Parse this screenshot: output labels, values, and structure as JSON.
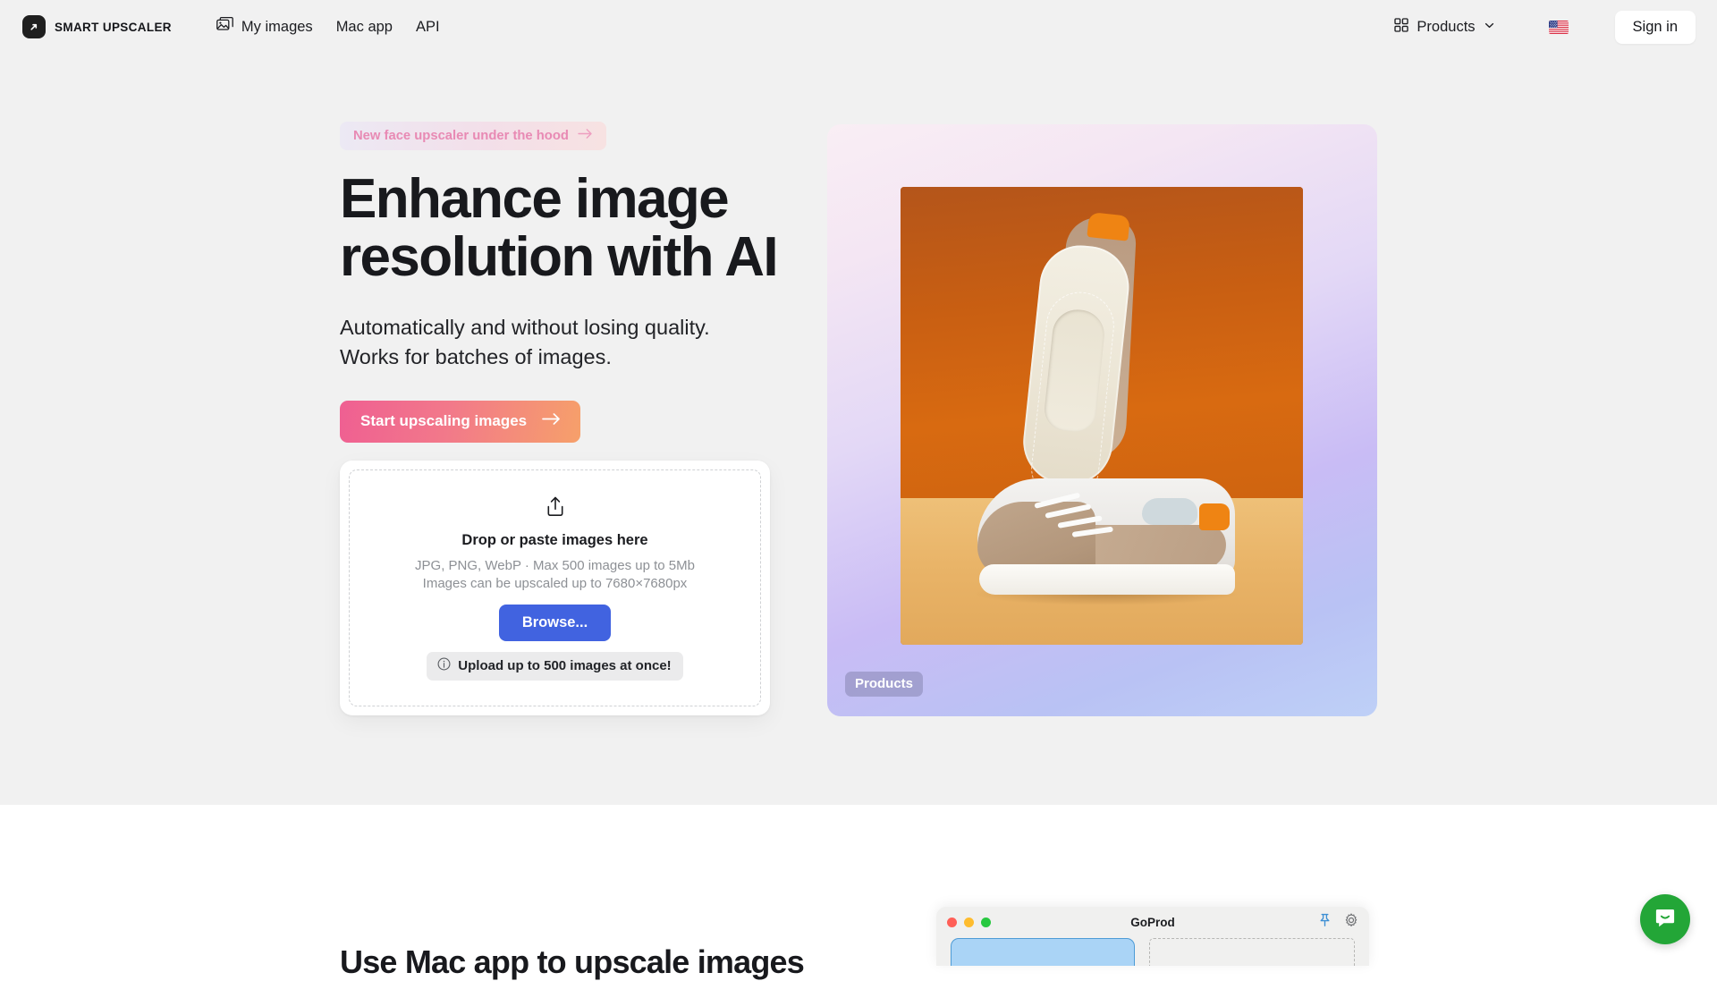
{
  "navbar": {
    "brand_icon": "expand-arrow-icon",
    "brand_name": "SMART UPSCALER",
    "links": [
      {
        "label": "My images",
        "icon": "images-stack-icon"
      },
      {
        "label": "Mac app",
        "icon": null
      },
      {
        "label": "API",
        "icon": null
      }
    ],
    "products_menu": {
      "label": "Products",
      "grid_icon": "grid-icon",
      "chevron_icon": "chevron-down-icon"
    },
    "language_flag": "us-flag-icon",
    "signin_label": "Sign in"
  },
  "hero": {
    "badge": {
      "text": "New face upscaler under the hood",
      "icon": "arrow-right-icon"
    },
    "title_line1": "Enhance image",
    "title_line2": "resolution with AI",
    "subtitle_line1": "Automatically and without losing quality.",
    "subtitle_line2": "Works for batches of images.",
    "cta_label": "Start upscaling images",
    "cta_icon": "arrow-right-icon"
  },
  "dropzone": {
    "upload_icon": "upload-share-icon",
    "title": "Drop or paste images here",
    "meta_line1": "JPG, PNG, WebP · Max 500 images up to 5Mb",
    "meta_line2": "Images can be upscaled up to 7680×7680px",
    "browse_label": "Browse...",
    "note_icon": "info-icon",
    "note_label": "Upload up to 500 images at once!"
  },
  "showcase": {
    "tag": "Products",
    "alt": "Pair of tan and white sneakers on orange backdrop"
  },
  "lower": {
    "title": "Use Mac app to upscale images",
    "mac_window": {
      "title": "GoProd",
      "pin_icon": "pin-icon",
      "settings_icon": "gear-icon",
      "traffic_lights": [
        "close-red",
        "minimize-yellow",
        "maximize-green"
      ]
    }
  },
  "chat": {
    "launcher_icon": "chat-bubble-smile-icon",
    "accent_color": "#23a637"
  },
  "colors": {
    "hero_background": "#f1f1f1",
    "page_background": "#ffffff",
    "text_primary": "#18191d",
    "text_muted": "#8d9095",
    "cta_gradient_from": "#ef5f92",
    "cta_gradient_to": "#f6a06a",
    "browse_blue": "#4163e0",
    "badge_text": "#e88ab4"
  }
}
